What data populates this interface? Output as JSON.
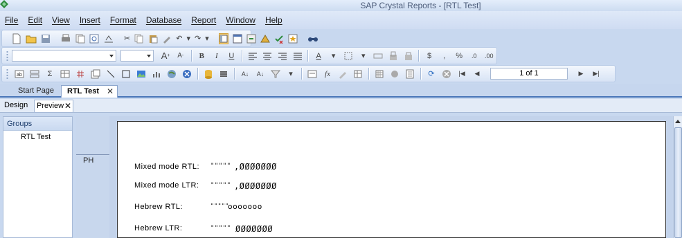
{
  "window": {
    "title": "SAP Crystal Reports - [RTL Test]"
  },
  "menu": [
    "File",
    "Edit",
    "View",
    "Insert",
    "Format",
    "Database",
    "Report",
    "Window",
    "Help"
  ],
  "toolbar3": {
    "page_indicator": "1 of 1"
  },
  "doc_tabs": {
    "start_page": "Start Page",
    "rtl_test": "RTL Test",
    "close_glyph": "✕"
  },
  "view_tabs": {
    "design": "Design",
    "preview": "Preview",
    "close_glyph": "✕"
  },
  "group_tree": {
    "header": "Groups",
    "node": "RTL Test"
  },
  "report": {
    "section_label": "PH",
    "rows": [
      {
        "label": "Mixed mode RTL:",
        "value1": "\"\"\"\"\"",
        "value2": ",ØØØØØØØ"
      },
      {
        "label": "Mixed mode LTR:",
        "value1": "\"\"\"\"\"",
        "value2": ",ØØØØØØØ"
      },
      {
        "label": "Hebrew RTL:",
        "value1": "\"\"\"\"\"",
        "value2": "ooooooo"
      },
      {
        "label": "Hebrew LTR:",
        "value1": "\"\"\"\"\"",
        "value2": "ØØØØØØØ"
      }
    ]
  },
  "colors": {
    "accent": "#4a76b8",
    "title_text": "#4a5a78",
    "group_header": "#1f3f6e"
  }
}
